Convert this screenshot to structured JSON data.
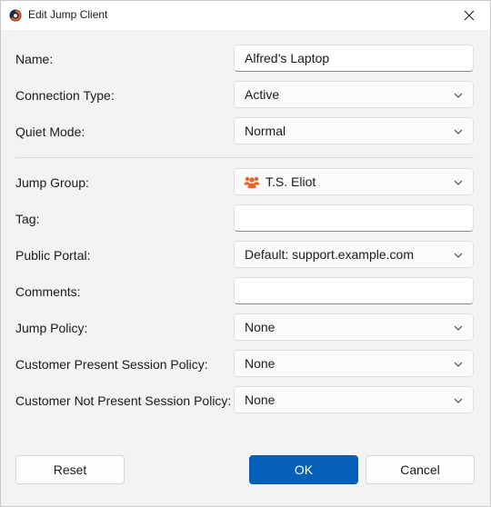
{
  "window": {
    "title": "Edit Jump Client",
    "close_icon": "close-icon",
    "app_icon": "jump-client-app-icon"
  },
  "fields": {
    "name": {
      "label": "Name:",
      "value": "Alfred’s Laptop"
    },
    "connection_type": {
      "label": "Connection Type:",
      "value": "Active"
    },
    "quiet_mode": {
      "label": "Quiet Mode:",
      "value": "Normal"
    },
    "jump_group": {
      "label": "Jump Group:",
      "value": "T.S. Eliot",
      "icon": "group-icon"
    },
    "tag": {
      "label": "Tag:",
      "value": ""
    },
    "public_portal": {
      "label": "Public Portal:",
      "value": "Default: support.example.com"
    },
    "comments": {
      "label": "Comments:",
      "value": ""
    },
    "jump_policy": {
      "label": "Jump Policy:",
      "value": "None"
    },
    "customer_present_session_policy": {
      "label": "Customer Present Session Policy:",
      "value": "None"
    },
    "customer_not_present_session_policy": {
      "label": "Customer Not Present Session Policy:",
      "value": "None"
    }
  },
  "buttons": {
    "reset": "Reset",
    "ok": "OK",
    "cancel": "Cancel"
  },
  "colors": {
    "accent": "#0560b9",
    "group_icon": "#e8632b",
    "background": "#f3f3f3"
  }
}
